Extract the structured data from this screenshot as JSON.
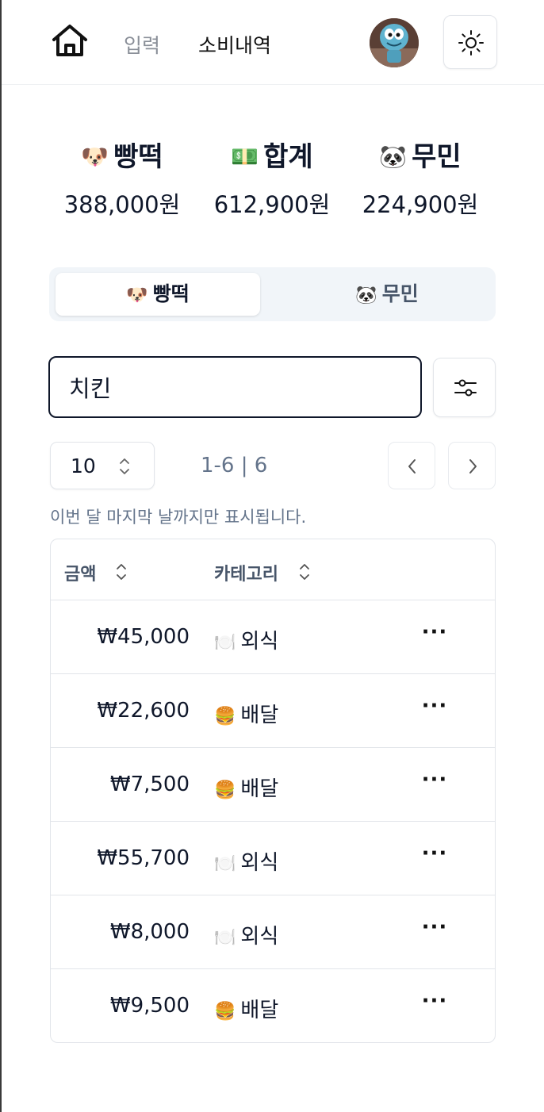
{
  "nav": {
    "input_label": "입력",
    "history_label": "소비내역"
  },
  "summary": [
    {
      "emoji": "🐶",
      "name": "빵떡",
      "amount": "388,000원"
    },
    {
      "emoji": "💵",
      "name": "합계",
      "amount": "612,900원"
    },
    {
      "emoji": "🐼",
      "name": "무민",
      "amount": "224,900원"
    }
  ],
  "tabs": [
    {
      "emoji": "🐶",
      "label": "빵떡",
      "active": true
    },
    {
      "emoji": "🐼",
      "label": "무민",
      "active": false
    }
  ],
  "search": {
    "value": "치킨"
  },
  "pagination": {
    "page_size": "10",
    "range": "1-6 | 6"
  },
  "note": "이번 달 마지막 날까지만 표시됩니다.",
  "table": {
    "columns": [
      "금액",
      "카테고리"
    ],
    "rows": [
      {
        "amount": "₩45,000",
        "emoji": "🍽️",
        "category": "외식"
      },
      {
        "amount": "₩22,600",
        "emoji": "🍔",
        "category": "배달"
      },
      {
        "amount": "₩7,500",
        "emoji": "🍔",
        "category": "배달"
      },
      {
        "amount": "₩55,700",
        "emoji": "🍽️",
        "category": "외식"
      },
      {
        "amount": "₩8,000",
        "emoji": "🍽️",
        "category": "외식"
      },
      {
        "amount": "₩9,500",
        "emoji": "🍔",
        "category": "배달"
      }
    ],
    "row_action": "···"
  },
  "icons": {
    "home": "home-icon",
    "theme": "sun-icon",
    "filter": "sliders-icon",
    "sort": "chevron-up-down-icon",
    "prev": "chevron-left-icon",
    "next": "chevron-right-icon"
  }
}
